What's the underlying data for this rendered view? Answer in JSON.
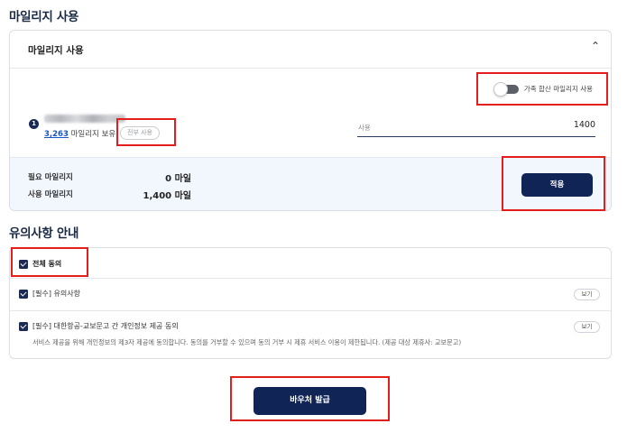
{
  "mileage_section": {
    "title": "마일리지 사용",
    "card_title": "마일리지 사용",
    "always_use_toggle_label": "가족 합산 마일리지 사용",
    "account": {
      "number": "1",
      "owned_amount": "3,263",
      "owned_suffix": " 마일리지 보유",
      "use_all_label": "전부 사용"
    },
    "use_field": {
      "label": "사용",
      "value": "1400"
    },
    "summary": {
      "required_label": "필요 마일리지",
      "required_value": "0 마일",
      "used_label": "사용 마일리지",
      "used_value": "1,400 마일"
    },
    "apply_label": "적용"
  },
  "notice_section": {
    "title": "유의사항 안내",
    "agree_all_label": "전체 동의",
    "items": [
      {
        "label": "[필수] 유의사항",
        "view_label": "보기"
      },
      {
        "label": "[필수] 대한항공-교보문고 간 개인정보 제공 동의",
        "view_label": "보기",
        "description": "서비스 제공을 위해 개인정보의 제3자 제공에 동의합니다. 동의를 거부할 수 있으며 동의 거부 시 제휴 서비스 이용이 제한됩니다. (제공 대상 제휴사: 교보문고)"
      }
    ]
  },
  "issue_voucher_label": "바우처 발급",
  "colors": {
    "primary": "#112456",
    "highlight": "#e41d1d",
    "summary_bg": "#f2f6fd"
  }
}
